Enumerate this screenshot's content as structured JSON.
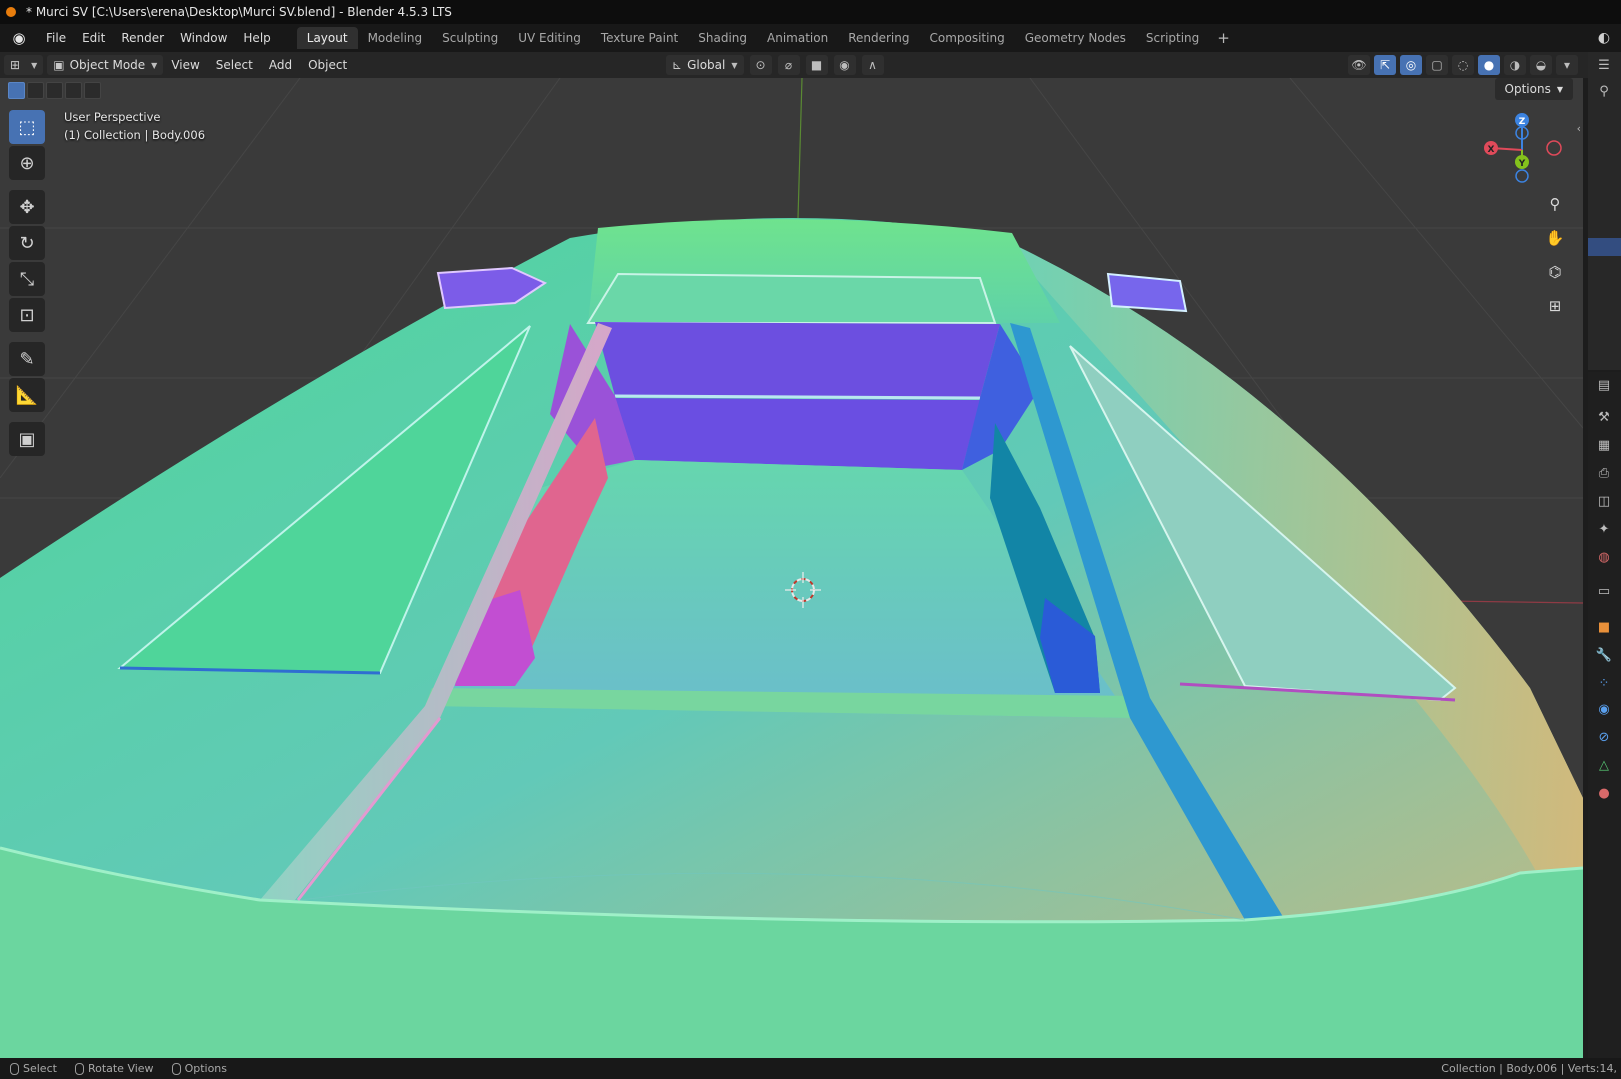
{
  "window": {
    "title": "* Murci SV [C:\\Users\\erena\\Desktop\\Murci SV.blend] - Blender 4.5.3 LTS"
  },
  "menus": [
    "File",
    "Edit",
    "Render",
    "Window",
    "Help"
  ],
  "workspaces": [
    "Layout",
    "Modeling",
    "Sculpting",
    "UV Editing",
    "Texture Paint",
    "Shading",
    "Animation",
    "Rendering",
    "Compositing",
    "Geometry Nodes",
    "Scripting"
  ],
  "active_workspace": "Layout",
  "header": {
    "mode": "Object Mode",
    "menus": [
      "View",
      "Select",
      "Add",
      "Object"
    ],
    "transform_orientation": "Global",
    "options_label": "Options"
  },
  "viewport": {
    "perspective": "User Perspective",
    "collection_info": "(1) Collection | Body.006",
    "axes": {
      "x": "X",
      "y": "Y",
      "z": "Z"
    },
    "shading": "solid",
    "colors": {
      "x_axis": "#e04a5a",
      "y_axis": "#84c21c",
      "z_axis": "#3c83e0",
      "grid": "#464646",
      "background": "#3a3a3a"
    }
  },
  "tools": [
    {
      "name": "select-box",
      "icon": "select-box-icon",
      "active": true
    },
    {
      "name": "cursor",
      "icon": "cursor-icon"
    },
    {
      "name": "move",
      "icon": "move-icon"
    },
    {
      "name": "rotate",
      "icon": "rotate-icon"
    },
    {
      "name": "scale",
      "icon": "scale-icon"
    },
    {
      "name": "transform",
      "icon": "transform-icon"
    },
    {
      "name": "annotate",
      "icon": "annotate-icon"
    },
    {
      "name": "measure",
      "icon": "measure-icon"
    },
    {
      "name": "add-cube",
      "icon": "add-cube-icon"
    }
  ],
  "statusbar": {
    "select": "Select",
    "rotate_view": "Rotate View",
    "options": "Options",
    "right_info": "Collection | Body.006 | Verts:14,"
  }
}
